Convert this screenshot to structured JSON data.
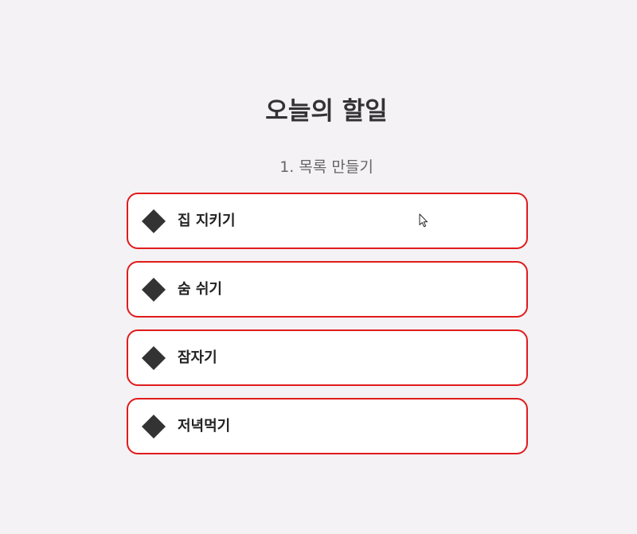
{
  "header": {
    "title": "오늘의 할일",
    "subtitle": "1. 목록 만들기"
  },
  "todos": {
    "items": [
      {
        "label": "집 지키기",
        "icon": "diamond-icon"
      },
      {
        "label": "숨 쉬기",
        "icon": "diamond-icon"
      },
      {
        "label": "잠자기",
        "icon": "diamond-icon"
      },
      {
        "label": "저녁먹기",
        "icon": "diamond-icon"
      }
    ]
  },
  "colors": {
    "background": "#f4f2f4",
    "item_border": "#e01b1b",
    "item_background": "#ffffff",
    "text": "#333333",
    "subtitle": "#666666",
    "icon": "#333333"
  },
  "cursor": {
    "icon": "mouse-pointer-icon"
  }
}
